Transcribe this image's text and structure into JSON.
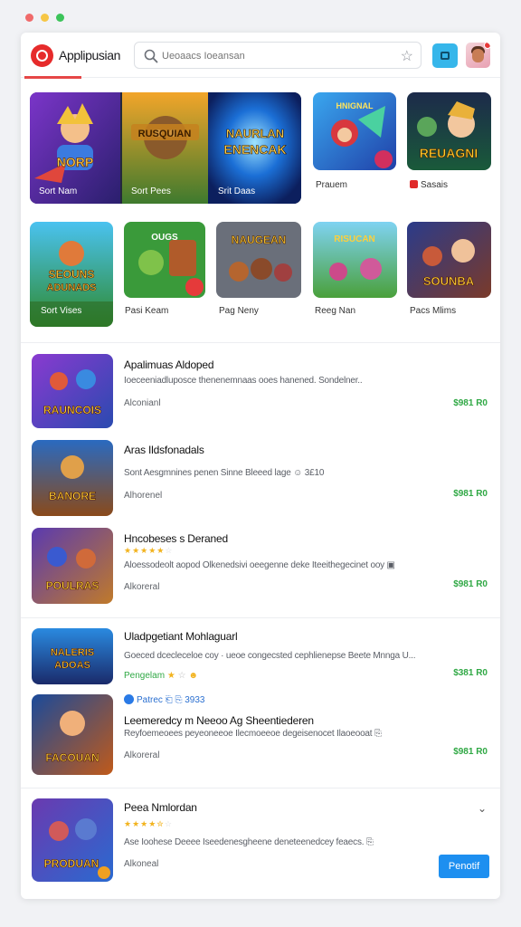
{
  "window_dots": [
    "#f06a6a",
    "#f6c645",
    "#3cc45a"
  ],
  "header": {
    "app_name": "Applipusian",
    "search_placeholder": "Ueoaacs Ioeansan",
    "search_icon": "magnifier-icon",
    "favorite_icon": "star-outline-icon",
    "action_icon": "window-icon",
    "accent": "#e62b2b"
  },
  "featured": [
    {
      "label": "Sort Nam",
      "art": "game-art-1"
    },
    {
      "label": "Sort Pees",
      "art": "game-art-2"
    },
    {
      "label": "Srit Daas",
      "art": "game-art-3"
    }
  ],
  "grid_row1": [
    {
      "label": "Prauem",
      "art": "game-art-4"
    },
    {
      "label": "Sasais",
      "art": "game-art-5"
    }
  ],
  "grid_row2": [
    {
      "label": "Sort Vises",
      "art": "game-art-6"
    },
    {
      "label": "Pasi Keam",
      "art": "game-art-7"
    },
    {
      "label": "Pag Neny",
      "art": "game-art-8"
    },
    {
      "label": "Reeg Nan",
      "art": "game-art-9"
    },
    {
      "label": "Pacs Mlims",
      "art": "game-art-10"
    }
  ],
  "list": [
    {
      "title": "Apalimuas Aldoped",
      "desc": "Ioeceeniadluposce thenenemnaas ooes hanened. Sondelner..",
      "sub": "Alconianl",
      "price": "$981 R0"
    },
    {
      "title": "Aras Ildsfonadals",
      "desc": "Sont Aesgmnines penen Sinne Bleeed lage ☺ 3£10",
      "sub": "Alhorenel",
      "price": "$981 R0"
    },
    {
      "title": "Hncobeses s Deraned",
      "desc": "Aloessodeolt aopod Olkenedsivi oeegenne deke Iteeithegecinet ooy ▣",
      "sub": "Alkoreral",
      "price": "$981 R0"
    }
  ],
  "list2": [
    {
      "title": "Uladpgetiant Mohlaguarl",
      "desc": "Goeced dcecleceloe coy · ueoe congecsted cephlienepse Beete Mnnga U...",
      "sub": "Pengelam",
      "price": "$381 R0"
    },
    {
      "tag": "Patrec ⎗ ⎘ 3933",
      "title": "Leemeredcy m Neeoo Ag Sheentiederen",
      "desc": "Reyfoemeoees peyeoneeoe Ilecmoeeoe degeisenocet Ilaoeooat ⎘",
      "sub": "Alkoreral",
      "price": "$981 R0"
    },
    {
      "title": "Peea Nmlordan",
      "desc": "Ase Ioohese Deeee Iseedenesgheene deneteenedcey feaecs. ⎘",
      "sub": "Alkoneal",
      "button": "Penotif"
    }
  ],
  "star_color": "#f2b31e",
  "price_color": "#2fa844",
  "button_color": "#1d8ff0"
}
